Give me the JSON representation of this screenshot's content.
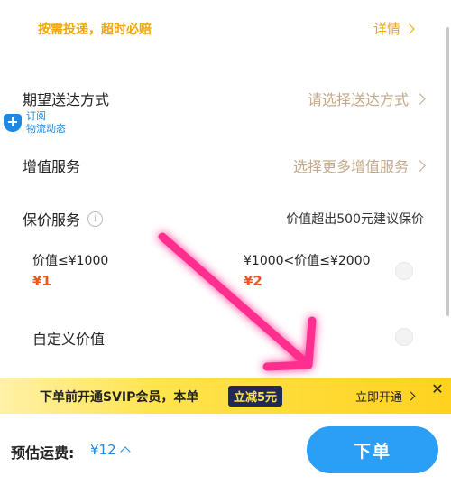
{
  "promise": {
    "text": "按需投递，超时必赔",
    "link": "详情"
  },
  "delivery": {
    "label": "期望送达方式",
    "placeholder": "请选择送达方式"
  },
  "subscribe": {
    "line1": "订阅",
    "line2": "物流动态"
  },
  "addon": {
    "label": "增值服务",
    "value": "选择更多增值服务"
  },
  "insure": {
    "label": "保价服务",
    "info_icon": "info-icon",
    "hint": "价值超出500元建议保价",
    "options": [
      {
        "range": "价值≤¥1000",
        "price": "¥1"
      },
      {
        "range": "¥1000<价值≤¥2000",
        "price": "¥2"
      }
    ],
    "custom": "自定义价值"
  },
  "banner": {
    "text": "下单前开通SVIP会员，本单",
    "tag": "立减5元",
    "action": "立即开通",
    "close": "✕"
  },
  "bottom": {
    "fee_label": "预估运费:",
    "fee_value": "¥12",
    "order_button": "下单"
  },
  "colors": {
    "accent": "#2a9ff5",
    "promise": "#f0a800",
    "price": "#f05423",
    "annotation_arrow": "#ff2d8f"
  }
}
